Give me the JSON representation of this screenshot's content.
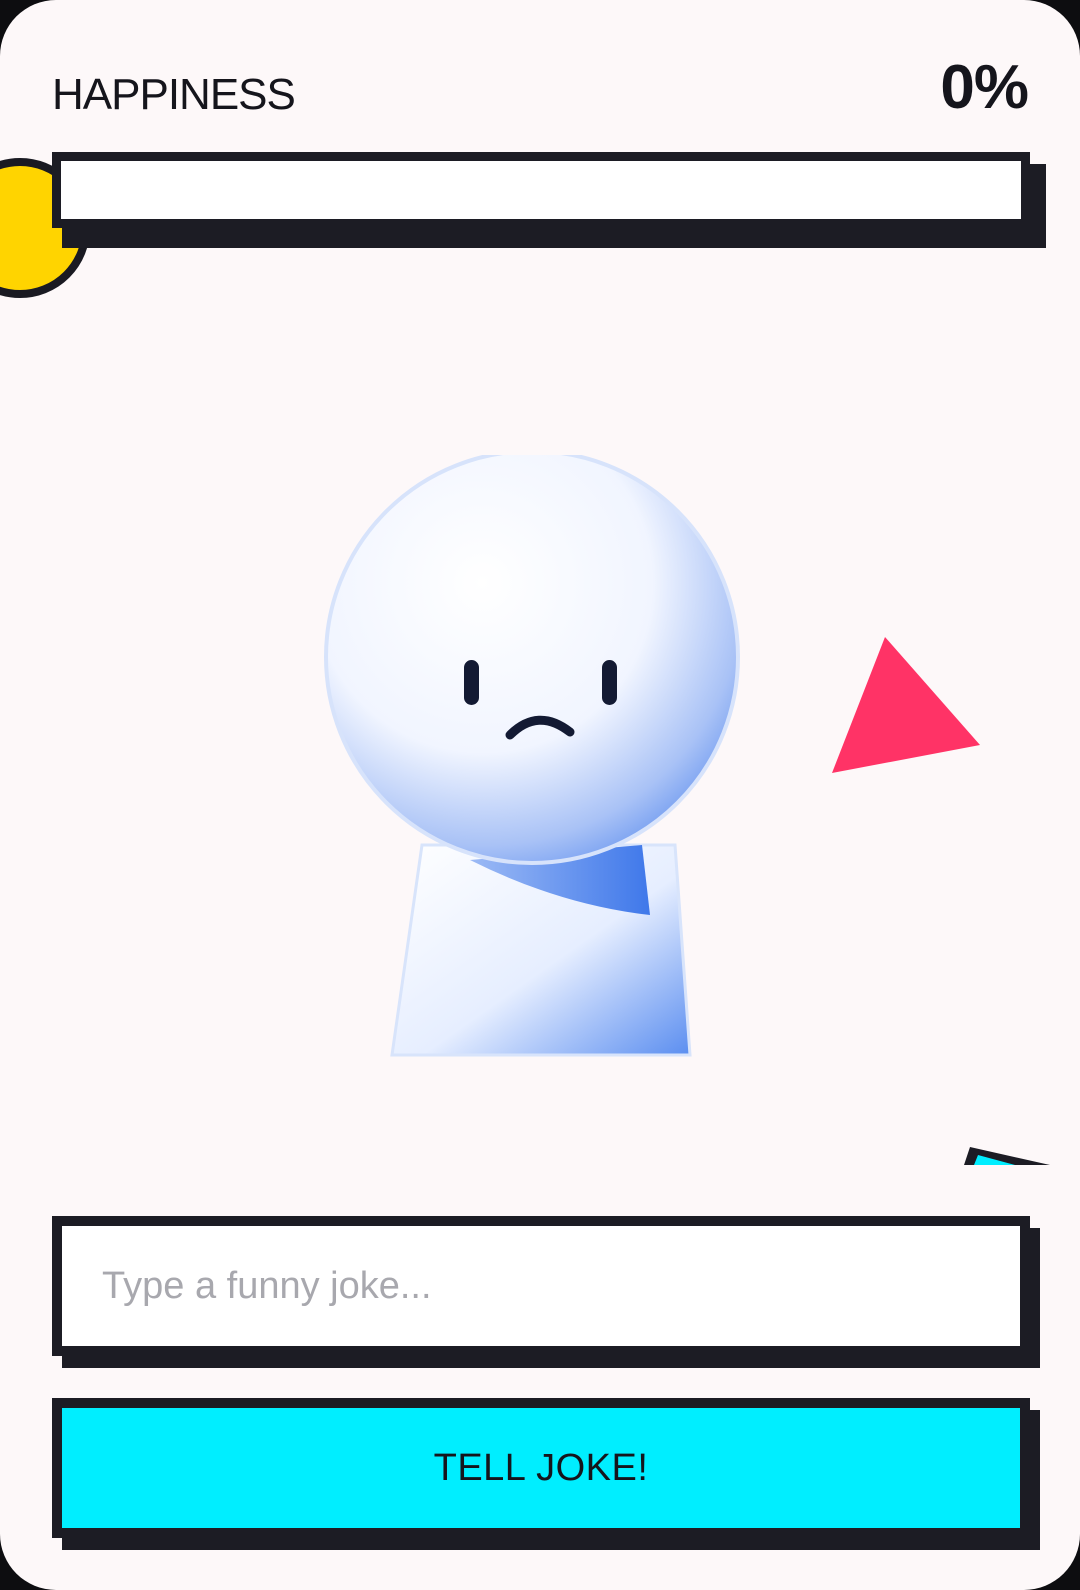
{
  "meter": {
    "label": "HAPPINESS",
    "value_text": "0%",
    "fraction": 0.0
  },
  "joke_input": {
    "placeholder": "Type a funny joke...",
    "value": ""
  },
  "action": {
    "label": "TELL JOKE!"
  },
  "mood": "sad",
  "colors": {
    "background": "#fdf8f9",
    "outline": "#1c1c24",
    "button": "#00eeff",
    "accent_circle": "#ffd400",
    "accent_triangle": "#ff3366",
    "character": "#5b8ef0"
  },
  "decorations": [
    "yellow-circle",
    "pink-triangle",
    "cyan-corner-shape"
  ]
}
